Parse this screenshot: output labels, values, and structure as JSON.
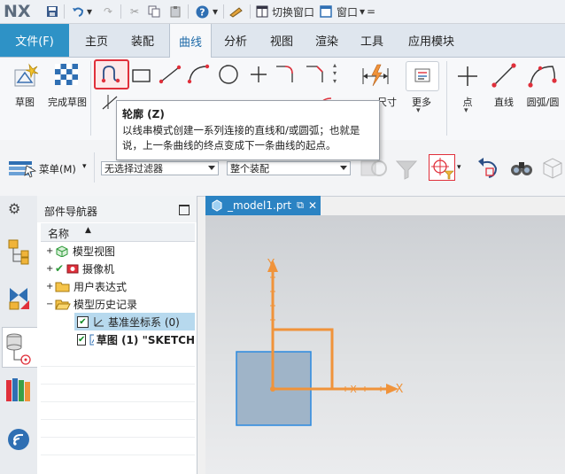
{
  "app": {
    "logo": "NX"
  },
  "quick_access": {
    "switch_window": "切换窗口",
    "window": "窗口"
  },
  "tabs": {
    "file": "文件(F)",
    "items": [
      "主页",
      "装配",
      "曲线",
      "分析",
      "视图",
      "渲染",
      "工具",
      "应用模块"
    ],
    "active": "曲线"
  },
  "ribbon": {
    "sketch": "草图",
    "finish_sketch": "完成草图",
    "more": "更多",
    "dimension_partial": "尺寸",
    "point": "点",
    "line": "直线",
    "arc_circle": "圆弧/圆"
  },
  "tooltip": {
    "title": "轮廓 (Z)",
    "description": "以线串模式创建一系列连接的直线和/或圆弧；也就是说，上一条曲线的终点变成下一条曲线的起点。"
  },
  "toolbar2": {
    "menu": "菜单(M)",
    "filter": "无选择过滤器",
    "assembly_scope": "整个装配"
  },
  "navigator": {
    "title": "部件导航器",
    "column_name": "名称",
    "items": {
      "model_views": "模型视图",
      "cameras": "摄像机",
      "user_expressions": "用户表达式",
      "model_history": "模型历史记录",
      "datum_csys": "基准坐标系 (0)",
      "sketch": "草图 (1) \"SKETCH"
    }
  },
  "document": {
    "tab": "_model1.prt"
  },
  "axes": {
    "x": "X",
    "y": "Y"
  },
  "colors": {
    "accent": "#2e92c6",
    "csys": "#f0933a",
    "selected_row": "#b7d9ee",
    "highlight_box": "#e0303b"
  }
}
